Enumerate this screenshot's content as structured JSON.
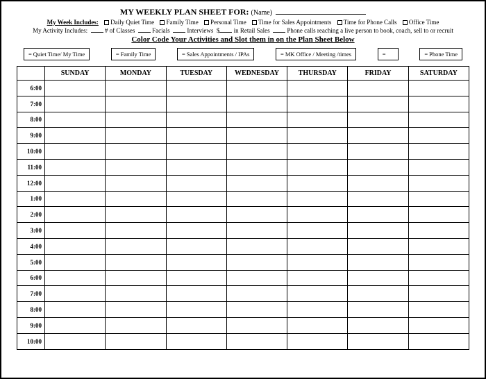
{
  "title": "MY WEEKLY PLAN SHEET FOR:",
  "name_label": "(Name)",
  "week_includes_lead": "My Week Includes:",
  "week_includes_items": [
    "Daily Quiet Time",
    "Family Time",
    "Personal Time",
    "Time for Sales Appointments",
    "Time for Phone Calls",
    "Office Time"
  ],
  "activity_lead": "My Activity Includes:",
  "activity_parts": {
    "p1": "# of Classes",
    "p2": "Facials",
    "p3": "Interviews",
    "p4": "$",
    "p5": "in Retail Sales",
    "p6": "Phone calls reaching a live person to book, coach, sell to or recruit"
  },
  "color_code": "Color Code Your Activities and Slot them in on the Plan Sheet Below",
  "legend": [
    "Quiet Time/ My Time",
    "Family Time",
    "Sales Appointments /   IPAs",
    "MK Office / Meeting /times",
    "",
    "Phone Time"
  ],
  "days": [
    "SUNDAY",
    "MONDAY",
    "TUESDAY",
    "WEDNESDAY",
    "THURSDAY",
    "FRIDAY",
    "SATURDAY"
  ],
  "times": [
    "6:00",
    "7:00",
    "8:00",
    "9:00",
    "10:00",
    "11:00",
    "12:00",
    "1:00",
    "2:00",
    "3:00",
    "4:00",
    "5:00",
    "6:00",
    "7:00",
    "8:00",
    "9:00",
    "10:00"
  ]
}
